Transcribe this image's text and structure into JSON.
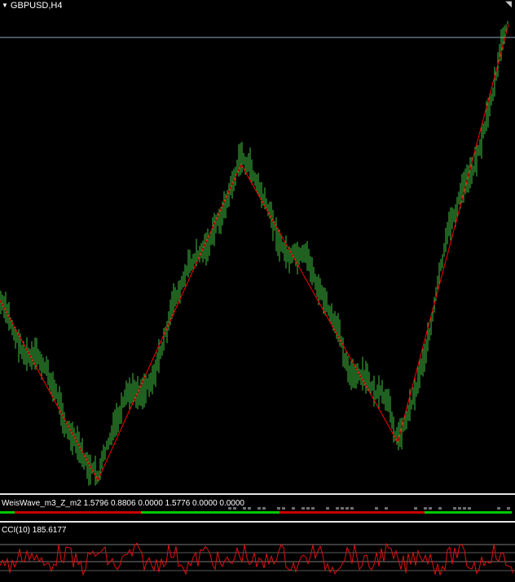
{
  "window": {
    "title": "GBPUSD,H4"
  },
  "indicators": {
    "weis_label": "WeisWave_m3_Z_m2 1.5796 0.8806 0.0000 1.5776 0.0000 0.0000",
    "cci_label": "CCI(10) 185.6177"
  },
  "colors": {
    "background": "#000000",
    "bars": "#3fbf3f",
    "zigzag": "#ff0000",
    "price_line": "#8fa8c0",
    "weis_up": "#00c800",
    "weis_down": "#c80000",
    "cci": "#e01010",
    "levels": "#7a7a7a"
  },
  "chart_data": {
    "type": "line",
    "symbol": "GBPUSD",
    "timeframe": "H4",
    "zigzag_pivots": [
      {
        "bar": 0,
        "label": "high"
      },
      {
        "bar": 120,
        "label": "low"
      },
      {
        "bar": 296,
        "label": "high"
      },
      {
        "bar": 488,
        "label": "low"
      },
      {
        "bar": 624,
        "label": "high"
      }
    ]
  }
}
